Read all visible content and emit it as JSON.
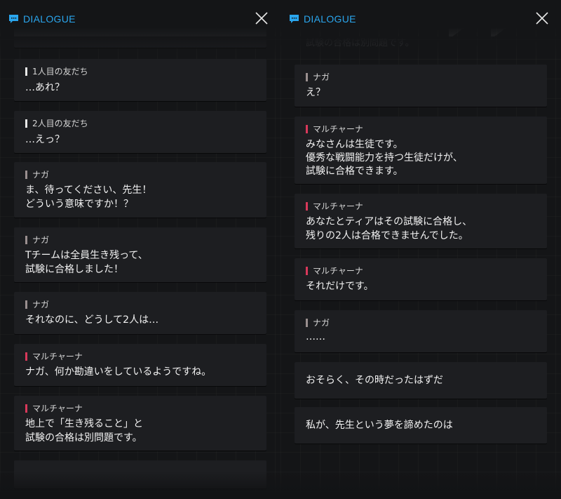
{
  "app": {
    "title": "DIALOGUE"
  },
  "colors": {
    "accent": "#2aa6ee",
    "bar_white": "#e8e8e8",
    "bar_grey": "#9a8f8f",
    "bar_red": "#d8385a"
  },
  "icons": {
    "dialogue": "chat-bubble-icon",
    "close": "close-icon"
  },
  "left_panel": {
    "cards": [
      {
        "speaker": "1人目の友だち",
        "bar": "white",
        "lines": [
          "…あれ？"
        ]
      },
      {
        "speaker": "2人目の友だち",
        "bar": "white",
        "lines": [
          "…えっ？"
        ]
      },
      {
        "speaker": "ナガ",
        "bar": "grey",
        "lines": [
          "ま、待ってください、先生！",
          "どういう意味ですか！？"
        ]
      },
      {
        "speaker": "ナガ",
        "bar": "grey",
        "lines": [
          "Tチームは全員生き残って、",
          "試験に合格しました！"
        ]
      },
      {
        "speaker": "ナガ",
        "bar": "grey",
        "lines": [
          "それなのに、どうして2人は…"
        ]
      },
      {
        "speaker": "マルチャーナ",
        "bar": "red",
        "lines": [
          "ナガ、何か勘違いをしているようですね。"
        ]
      },
      {
        "speaker": "マルチャーナ",
        "bar": "red",
        "lines": [
          "地上で「生き残ること」と",
          "試験の合格は別問題です。"
        ]
      }
    ]
  },
  "right_panel": {
    "ghost_text": "試験の合格は別問題です。",
    "cards": [
      {
        "speaker": "ナガ",
        "bar": "grey",
        "lines": [
          "え？"
        ]
      },
      {
        "speaker": "マルチャーナ",
        "bar": "red",
        "lines": [
          "みなさんは生徒です。",
          "優秀な戦闘能力を持つ生徒だけが、",
          "試験に合格できます。"
        ]
      },
      {
        "speaker": "マルチャーナ",
        "bar": "red",
        "lines": [
          "あなたとティアはその試験に合格し、",
          "残りの2人は合格できませんでした。"
        ]
      },
      {
        "speaker": "マルチャーナ",
        "bar": "red",
        "lines": [
          "それだけです。"
        ]
      },
      {
        "speaker": "ナガ",
        "bar": "grey",
        "lines": [
          "……"
        ]
      }
    ],
    "narration": [
      {
        "text": "おそらく、その時だったはずだ"
      },
      {
        "text": "私が、先生という夢を諦めたのは"
      }
    ]
  }
}
